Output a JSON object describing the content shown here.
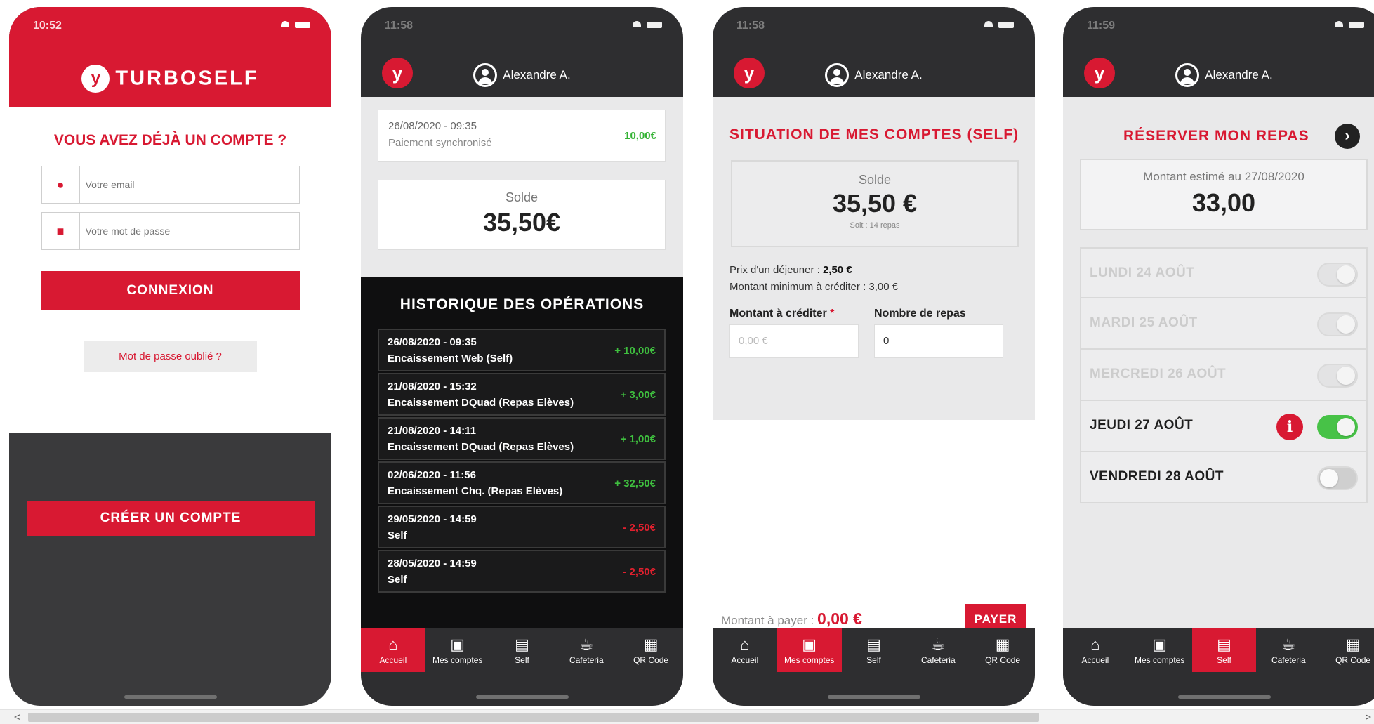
{
  "colors": {
    "brand_red": "#d81932",
    "dark_header": "#2e2e30",
    "positive": "#3fbf3f",
    "negative": "#e0202e",
    "toggle_on": "#47c247"
  },
  "screen1": {
    "time": "10:52",
    "brand": "TURBOSELF",
    "title": "VOUS AVEZ DÉJÀ UN COMPTE ?",
    "email_placeholder": "Votre email",
    "password_placeholder": "Votre mot de passe",
    "login_button": "CONNEXION",
    "forgot_link": "Mot de passe oublié ?",
    "create_button": "CRÉER UN COMPTE",
    "icons": {
      "email": "user-icon",
      "password": "lock-icon",
      "logo": "turboself-logo-icon"
    }
  },
  "user_name": "Alexandre A.",
  "screen2": {
    "time": "11:58",
    "sync": {
      "date": "26/08/2020 - 09:35",
      "label": "Paiement synchronisé",
      "amount": "10,00€"
    },
    "solde_label": "Solde",
    "solde_amount": "35,50€",
    "history_title": "HISTORIQUE DES OPÉRATIONS",
    "operations": [
      {
        "date": "26/08/2020 - 09:35",
        "label": "Encaissement Web (Self)",
        "amount": "+ 10,00€",
        "sign": "pos"
      },
      {
        "date": "21/08/2020 - 15:32",
        "label": "Encaissement DQuad (Repas Elèves)",
        "amount": "+ 3,00€",
        "sign": "pos"
      },
      {
        "date": "21/08/2020 - 14:11",
        "label": "Encaissement DQuad (Repas Elèves)",
        "amount": "+ 1,00€",
        "sign": "pos"
      },
      {
        "date": "02/06/2020 - 11:56",
        "label": "Encaissement Chq. (Repas Elèves)",
        "amount": "+ 32,50€",
        "sign": "pos"
      },
      {
        "date": "29/05/2020 - 14:59",
        "label": "Self",
        "amount": "- 2,50€",
        "sign": "neg"
      },
      {
        "date": "28/05/2020 - 14:59",
        "label": "Self",
        "amount": "- 2,50€",
        "sign": "neg"
      }
    ],
    "active_tab": "Accueil"
  },
  "screen3": {
    "time": "11:58",
    "title": "SITUATION DE MES COMPTES (SELF)",
    "solde_label": "Solde",
    "solde_amount": "35,50 €",
    "solde_sub": "Soit : 14 repas",
    "price_label": "Prix d'un déjeuner : ",
    "price_value": "2,50 €",
    "min_credit": "Montant minimum à créditer : 3,00 €",
    "credit_label": "Montant à créditer",
    "credit_star": "*",
    "credit_placeholder": "0,00 €",
    "meals_label": "Nombre de repas",
    "meals_value": "0",
    "to_pay_label": "Montant à payer : ",
    "to_pay_value": "0,00 €",
    "pay_button": "PAYER",
    "active_tab": "Mes comptes"
  },
  "screen4": {
    "time": "11:59",
    "title": "RÉSERVER MON REPAS",
    "next_icon": "chevron-right-icon",
    "estimate_label": "Montant estimé au 27/08/2020",
    "estimate_amount": "33,00",
    "days": [
      {
        "label": "LUNDI 24 AOÛT",
        "state": "disabled"
      },
      {
        "label": "MARDI 25 AOÛT",
        "state": "disabled"
      },
      {
        "label": "MERCREDI 26 AOÛT",
        "state": "disabled"
      },
      {
        "label": "JEUDI 27 AOÛT",
        "state": "on"
      },
      {
        "label": "VENDREDI 28 AOÛT",
        "state": "off"
      }
    ],
    "info_glyph": "i",
    "active_tab": "Self"
  },
  "tabs": [
    {
      "label": "Accueil",
      "icon": "home-icon",
      "glyph": "⌂"
    },
    {
      "label": "Mes comptes",
      "icon": "wallet-icon",
      "glyph": "▣"
    },
    {
      "label": "Self",
      "icon": "tray-icon",
      "glyph": "▤"
    },
    {
      "label": "Cafeteria",
      "icon": "cafeteria-icon",
      "glyph": "☕"
    },
    {
      "label": "QR Code",
      "icon": "qr-code-icon",
      "glyph": "▦"
    }
  ],
  "scrollbar": {
    "left_arrow": "<",
    "right_arrow": ">"
  }
}
